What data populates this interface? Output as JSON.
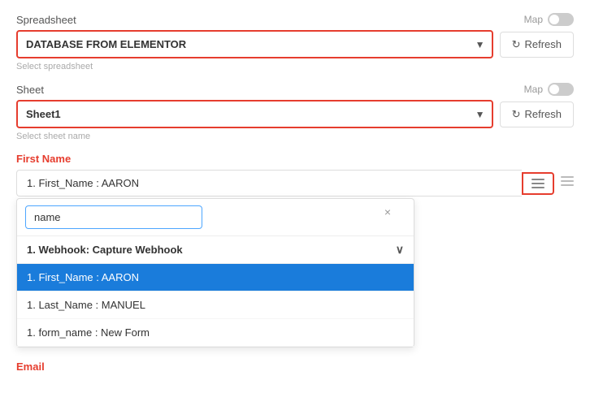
{
  "spreadsheet": {
    "label": "Spreadsheet",
    "map_label": "Map",
    "select_value": "DATABASE FROM ELEMENTOR",
    "helper_text": "Select spreadsheet",
    "refresh_label": "Refresh",
    "arrow": "▼"
  },
  "sheet": {
    "label": "Sheet",
    "map_label": "Map",
    "select_value": "Sheet1",
    "helper_text": "Select sheet name",
    "refresh_label": "Refresh",
    "arrow": "▼"
  },
  "first_name": {
    "label": "First Name",
    "value": "1. First_Name : AARON",
    "menu_icon_label": "menu"
  },
  "dropdown": {
    "search_placeholder": "name",
    "clear_icon": "×",
    "group_label": "1. Webhook: Capture Webhook",
    "items": [
      {
        "label": "1. First_Name : AARON",
        "selected": true
      },
      {
        "label": "1. Last_Name : MANUEL",
        "selected": false
      },
      {
        "label": "1. form_name : New Form",
        "selected": false
      }
    ]
  },
  "email": {
    "label": "Email"
  },
  "icons": {
    "refresh": "↻",
    "chevron_down": "∨",
    "menu_line": "≡",
    "search_clear": "×"
  }
}
